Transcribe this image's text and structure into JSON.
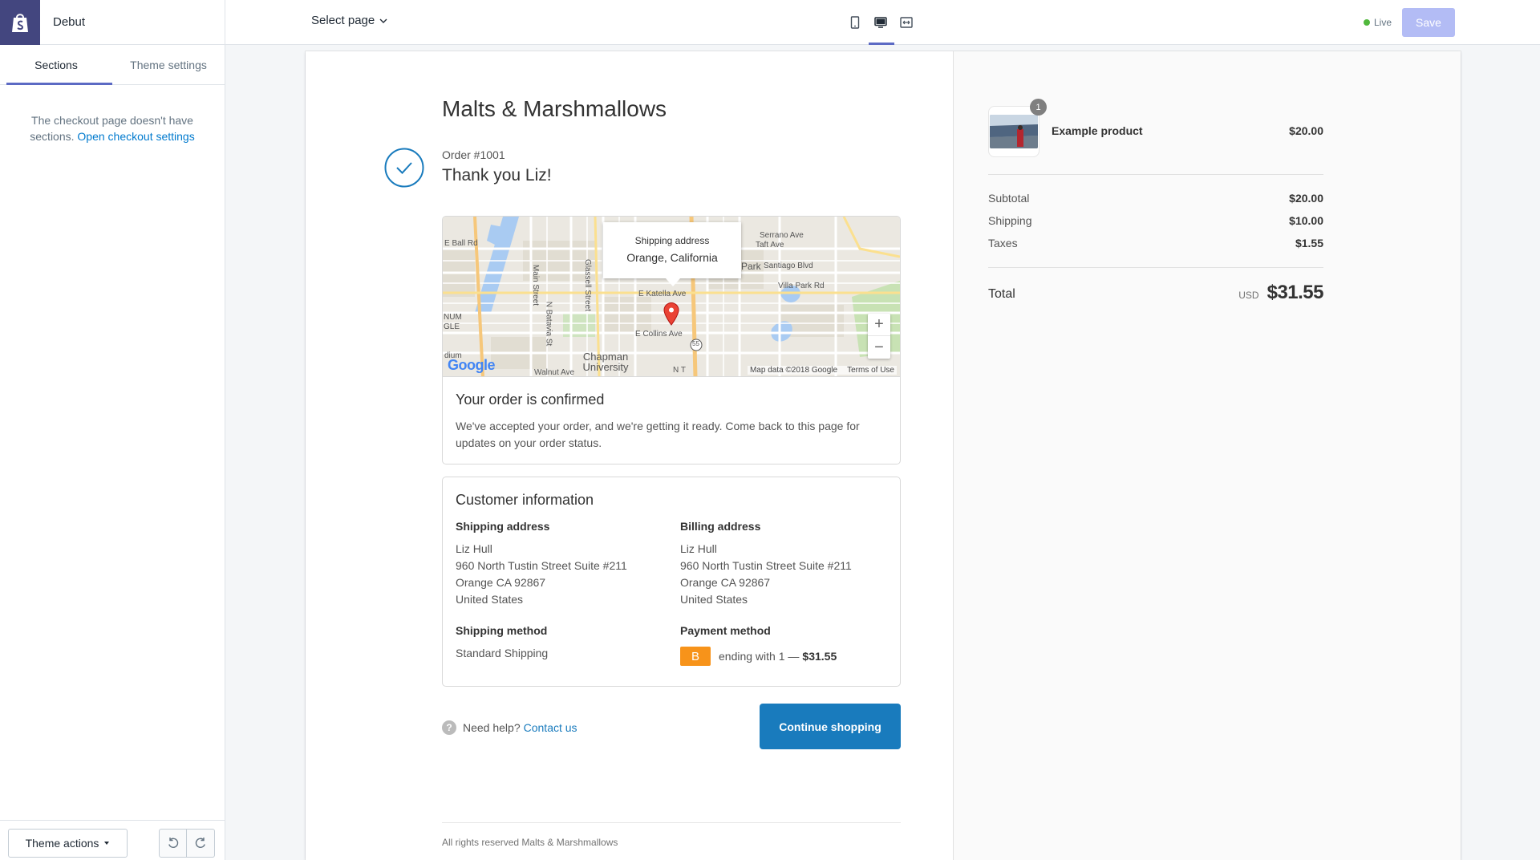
{
  "topbar": {
    "theme_name": "Debut",
    "select_page_label": "Select page",
    "status_label": "Live",
    "save_label": "Save"
  },
  "sidebar": {
    "tabs": [
      {
        "label": "Sections",
        "active": true
      },
      {
        "label": "Theme settings",
        "active": false
      }
    ],
    "message": "The checkout page doesn't have sections.",
    "message_link": "Open checkout settings",
    "theme_actions_label": "Theme actions"
  },
  "checkout": {
    "shop_name": "Malts & Marshmallows",
    "order_number": "Order #1001",
    "thank_you": "Thank you Liz!",
    "map": {
      "tooltip_label": "Shipping address",
      "tooltip_value": "Orange, California",
      "labels": [
        "E Ball Rd",
        "Main Street",
        "Glassell Street",
        "N Batavia St",
        "E Katella Ave",
        "E Collins Ave",
        "Serrano Ave",
        "Taft Ave",
        "Santiago Blvd",
        "Villa Park Rd",
        "Chapman University",
        "Walnut Ave",
        "Park",
        "NUM",
        "GLE",
        "dium",
        "N T"
      ],
      "route_label": "55",
      "credits": [
        "Map data ©2018 Google",
        "Terms of Use"
      ],
      "google_label": "Google"
    },
    "confirm": {
      "title": "Your order is confirmed",
      "text": "We've accepted your order, and we're getting it ready. Come back to this page for updates on your order status."
    },
    "customer": {
      "title": "Customer information",
      "shipping_address_label": "Shipping address",
      "shipping_address": [
        "Liz Hull",
        "960 North Tustin Street Suite #211",
        "Orange CA 92867",
        "United States"
      ],
      "billing_address_label": "Billing address",
      "billing_address": [
        "Liz Hull",
        "960 North Tustin Street Suite #211",
        "Orange CA 92867",
        "United States"
      ],
      "shipping_method_label": "Shipping method",
      "shipping_method": "Standard Shipping",
      "payment_method_label": "Payment method",
      "payment_icon_letter": "B",
      "payment_text": "ending with 1 —",
      "payment_amount": "$31.55"
    },
    "help_icon": "?",
    "help_text": "Need help?",
    "help_link": "Contact us",
    "continue_label": "Continue shopping",
    "footer": "All rights reserved Malts & Marshmallows"
  },
  "summary": {
    "product": {
      "name": "Example product",
      "price": "$20.00",
      "quantity": "1"
    },
    "rows": [
      {
        "label": "Subtotal",
        "value": "$20.00"
      },
      {
        "label": "Shipping",
        "value": "$10.00"
      },
      {
        "label": "Taxes",
        "value": "$1.55"
      }
    ],
    "total_label": "Total",
    "currency": "USD",
    "total_value": "$31.55"
  },
  "colors": {
    "brand_logo_bg": "#43467f",
    "accent": "#5c6ac4",
    "link": "#197bbd",
    "button": "#197bbd",
    "live_dot": "#50b83c",
    "payment_icon": "#f7931a"
  },
  "icons": {
    "logo": "shopping-bag-icon",
    "select_page": "chevron-down-icon",
    "views": [
      "mobile-icon",
      "desktop-icon",
      "fullscreen-icon"
    ],
    "undo": "undo-icon",
    "redo": "redo-icon",
    "confirm": "check-circle-icon",
    "map_pin": "map-pin-icon"
  }
}
